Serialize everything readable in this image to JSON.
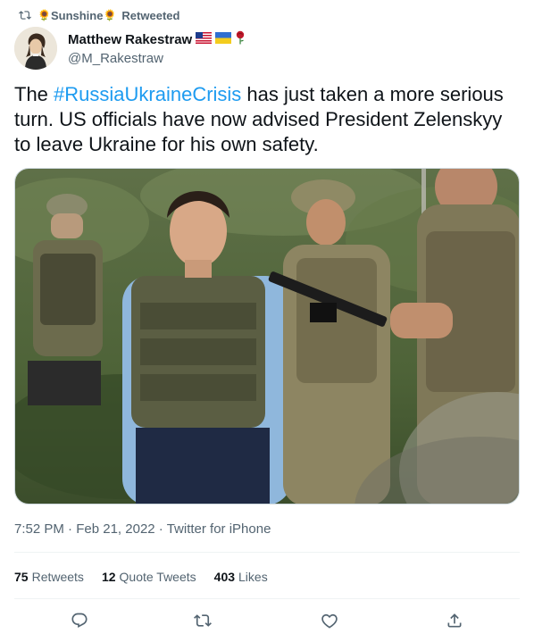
{
  "retweeted_by": {
    "name": "Sunshine",
    "label": "Retweeted",
    "emoji": "🌻"
  },
  "author": {
    "display_name": "Matthew Rakestraw",
    "handle": "@M_Rakestraw",
    "badges": [
      "us-flag",
      "ukraine-flag",
      "rose"
    ]
  },
  "tweet": {
    "text_before": "The ",
    "hashtag": "#RussiaUkraineCrisis",
    "text_after": " has just taken a more serious turn. US officials have now advised President Zelenskyy to leave Ukraine for his own safety."
  },
  "meta": {
    "time": "7:52 PM",
    "sep1": " · ",
    "date": "Feb 21, 2022",
    "sep2": " · ",
    "source": "Twitter for iPhone"
  },
  "stats": {
    "retweets_count": "75",
    "retweets_label": "Retweets",
    "quotes_count": "12",
    "quotes_label": "Quote Tweets",
    "likes_count": "403",
    "likes_label": "Likes"
  },
  "actions": [
    "reply-icon",
    "retweet-icon",
    "like-icon",
    "share-icon"
  ],
  "colors": {
    "accent": "#1d9bf0",
    "secondary_text": "#536471",
    "primary_text": "#0f1419",
    "divider": "#eff3f4"
  }
}
